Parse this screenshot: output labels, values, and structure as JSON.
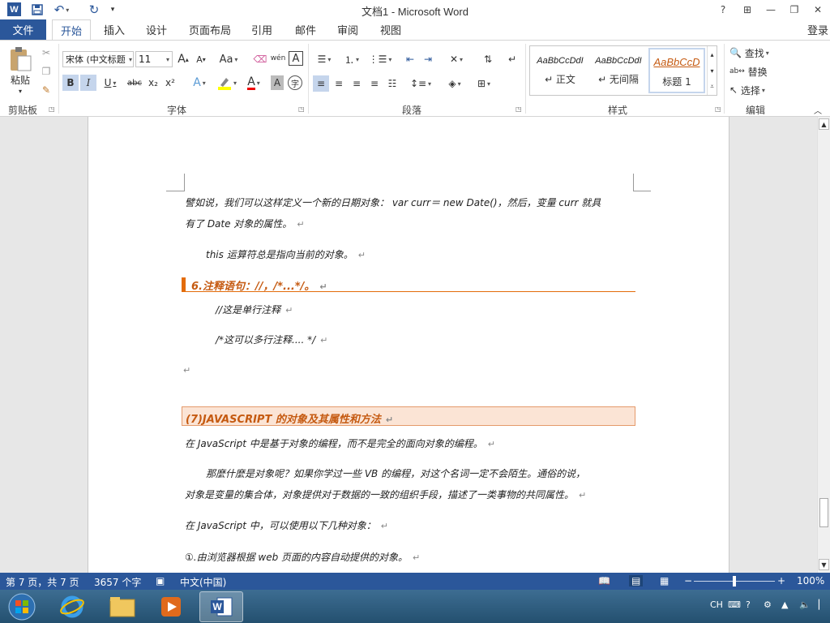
{
  "app": {
    "title": "文档1 - Microsoft Word",
    "login": "登录"
  },
  "quick_access": {
    "word_logo": "W",
    "save_icon": "save-icon",
    "undo_icon": "undo-icon",
    "redo_icon": "redo-icon",
    "customize_icon": "customize-icon"
  },
  "window_buttons": {
    "help": "?",
    "ribbon_display": "⊞",
    "minimize": "—",
    "restore": "❐",
    "close": "✕"
  },
  "tabs": [
    {
      "label": "文件"
    },
    {
      "label": "开始"
    },
    {
      "label": "插入"
    },
    {
      "label": "设计"
    },
    {
      "label": "页面布局"
    },
    {
      "label": "引用"
    },
    {
      "label": "邮件"
    },
    {
      "label": "审阅"
    },
    {
      "label": "视图"
    }
  ],
  "ribbon": {
    "clipboard": {
      "paste": "粘贴",
      "group": "剪贴板"
    },
    "font": {
      "font_name": "宋体 (中文标题",
      "font_size": "11",
      "grow": "A",
      "shrink": "A",
      "case": "Aa",
      "phonetic": "wén",
      "bold": "B",
      "italic": "I",
      "underline": "U",
      "strike": "abc",
      "subscript": "x₂",
      "superscript": "x²",
      "text_effect": "A",
      "font_color": "A",
      "char_shade": "A",
      "enclose": "字",
      "group": "字体"
    },
    "paragraph": {
      "group": "段落"
    },
    "styles": {
      "items": [
        {
          "preview": "AaBbCcDdI",
          "name": "↵ 正文"
        },
        {
          "preview": "AaBbCcDdI",
          "name": "↵ 无间隔"
        },
        {
          "preview": "AaBbCcD",
          "name": "标题 1"
        }
      ],
      "group": "样式"
    },
    "editing": {
      "find": "查找",
      "replace": "替换",
      "select": "选择",
      "group": "编辑"
    }
  },
  "document": {
    "lines": [
      "譬如说，我们可以这样定义一个新的日期对象： var curr＝ new Date()，然后，变量 curr 就具",
      "有了 Date 对象的属性。",
      "this 运算符总是指向当前的对象。",
      "//这是单行注释",
      "/*这可以多行注释.... */",
      "在 JavaScript 中是基于对象的编程，而不是完全的面向对象的编程。",
      "那麼什麼是对象呢？如果你学过一些 VB 的编程，对这个名词一定不会陌生。通俗的说，",
      "对象是变量的集合体，对象提供对于数据的一致的组织手段，描述了一类事物的共同属性。",
      "在 JavaScript 中，可以使用以下几种对象：",
      "①.由浏览器根据 web 页面的内容自动提供的对象。"
    ],
    "heading6": "6.注释语句：//，/*...*/。",
    "heading7": "(7)JAVASCRIPT 的对象及其属性和方法",
    "para_mark": "↵"
  },
  "status_bar": {
    "page": "第 7 页，共 7 页",
    "words": "3657 个字",
    "language": "中文(中国)",
    "zoom": "100%",
    "zoom_level": 1.0
  },
  "taskbar": {
    "tray_lang": "CH"
  },
  "colors": {
    "word_blue": "#2b579a",
    "heading_orange": "#c55a11",
    "heading_bg": "#fbe4d5"
  }
}
